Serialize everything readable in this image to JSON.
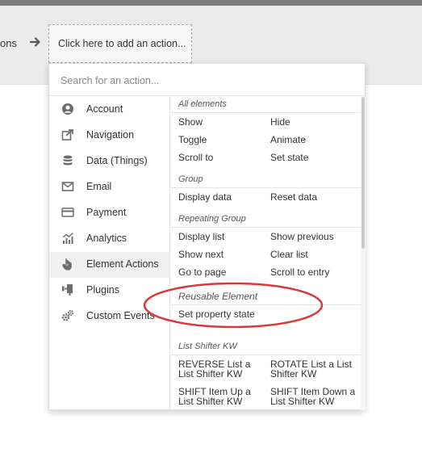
{
  "workflow": {
    "prev_step_text": "ons",
    "add_action_label": "Click here to add an action..."
  },
  "search": {
    "placeholder": "Search for an action..."
  },
  "categories": [
    {
      "label": "Account",
      "icon": "user-circle-icon"
    },
    {
      "label": "Navigation",
      "icon": "share-arrow-icon"
    },
    {
      "label": "Data (Things)",
      "icon": "database-icon"
    },
    {
      "label": "Email",
      "icon": "envelope-icon"
    },
    {
      "label": "Payment",
      "icon": "credit-card-icon"
    },
    {
      "label": "Analytics",
      "icon": "line-chart-icon"
    },
    {
      "label": "Element Actions",
      "icon": "hand-pointer-icon",
      "active": true
    },
    {
      "label": "Plugins",
      "icon": "plug-icon"
    },
    {
      "label": "Custom Events",
      "icon": "gears-icon"
    }
  ],
  "groups": {
    "all_elements": {
      "title": "All elements",
      "actions": [
        "Show",
        "Hide",
        "Toggle",
        "Animate",
        "Scroll to",
        "Set state"
      ]
    },
    "group": {
      "title": "Group",
      "actions": [
        "Display data",
        "Reset data"
      ]
    },
    "repeating_group": {
      "title": "Repeating Group",
      "actions": [
        "Display list",
        "Show previous",
        "Show next",
        "Clear list",
        "Go to page",
        "Scroll to entry"
      ]
    },
    "reusable_element": {
      "title": "Reusable Element",
      "actions": [
        "Set property state"
      ]
    },
    "list_shifter": {
      "title": "List Shifter KW",
      "actions": [
        "REVERSE List a List Shifter KW",
        "ROTATE List a List Shifter KW",
        "SHIFT Item Up a List Shifter KW",
        "SHIFT Item Down a List Shifter KW"
      ]
    }
  },
  "colors": {
    "annotation_ellipse": "#d9383a",
    "active_category_bg": "#f0f0f0"
  }
}
